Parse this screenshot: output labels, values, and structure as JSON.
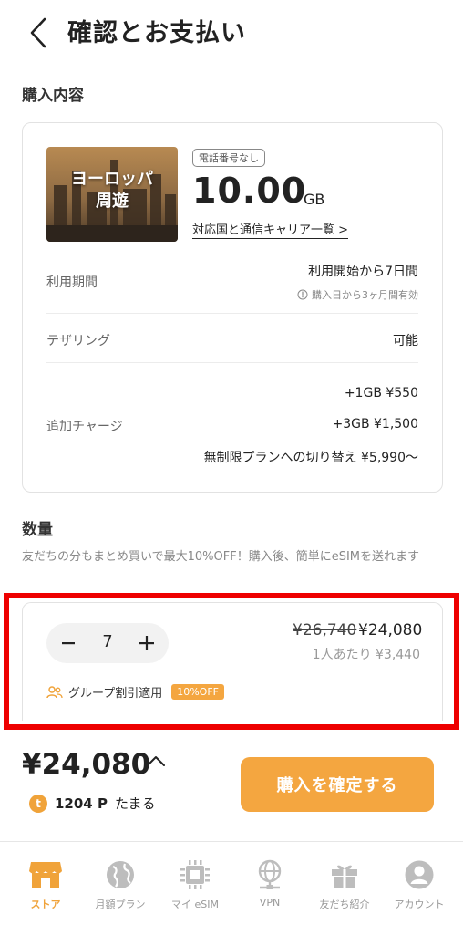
{
  "header": {
    "title": "確認とお支払い"
  },
  "purchase": {
    "section_title": "購入内容",
    "thumbnail_label": "ヨーロッパ\n周遊",
    "phone_tag": "電話番号なし",
    "data_amount": "10.00",
    "data_unit": "GB",
    "carrier_link": "対応国と通信キャリア一覧 >",
    "period_label": "利用期間",
    "period_value": "利用開始から7日間",
    "period_note": "購入日から3ヶ月間有効",
    "tethering_label": "テザリング",
    "tethering_value": "可能",
    "charge_label": "追加チャージ",
    "charge_options": [
      "+1GB ¥550",
      "+3GB ¥1,500",
      "無制限プランへの切り替え ¥5,990〜"
    ]
  },
  "quantity": {
    "section_title": "数量",
    "description": "友だちの分もまとめ買いで最大10%OFF！購入後、簡単にeSIMを送れます",
    "value": "7",
    "price_original": "¥26,740",
    "price_discounted": "¥24,080",
    "per_person": "1人あたり ¥3,440",
    "group_label": "グループ割引適用",
    "discount_badge": "10%OFF"
  },
  "footer": {
    "total": "¥24,080",
    "points_value": "1204 P",
    "points_label": "たまる",
    "coin_letter": "t",
    "confirm_button": "購入を確定する"
  },
  "tabs": [
    {
      "label": "ストア",
      "icon": "store-icon",
      "active": true
    },
    {
      "label": "月額プラン",
      "icon": "globe-icon",
      "active": false
    },
    {
      "label": "マイ eSIM",
      "icon": "chip-icon",
      "active": false
    },
    {
      "label": "VPN",
      "icon": "network-icon",
      "active": false
    },
    {
      "label": "友だち紹介",
      "icon": "gift-icon",
      "active": false
    },
    {
      "label": "アカウント",
      "icon": "account-icon",
      "active": false
    }
  ],
  "colors": {
    "accent": "#f4a640",
    "highlight": "#ee0000"
  }
}
